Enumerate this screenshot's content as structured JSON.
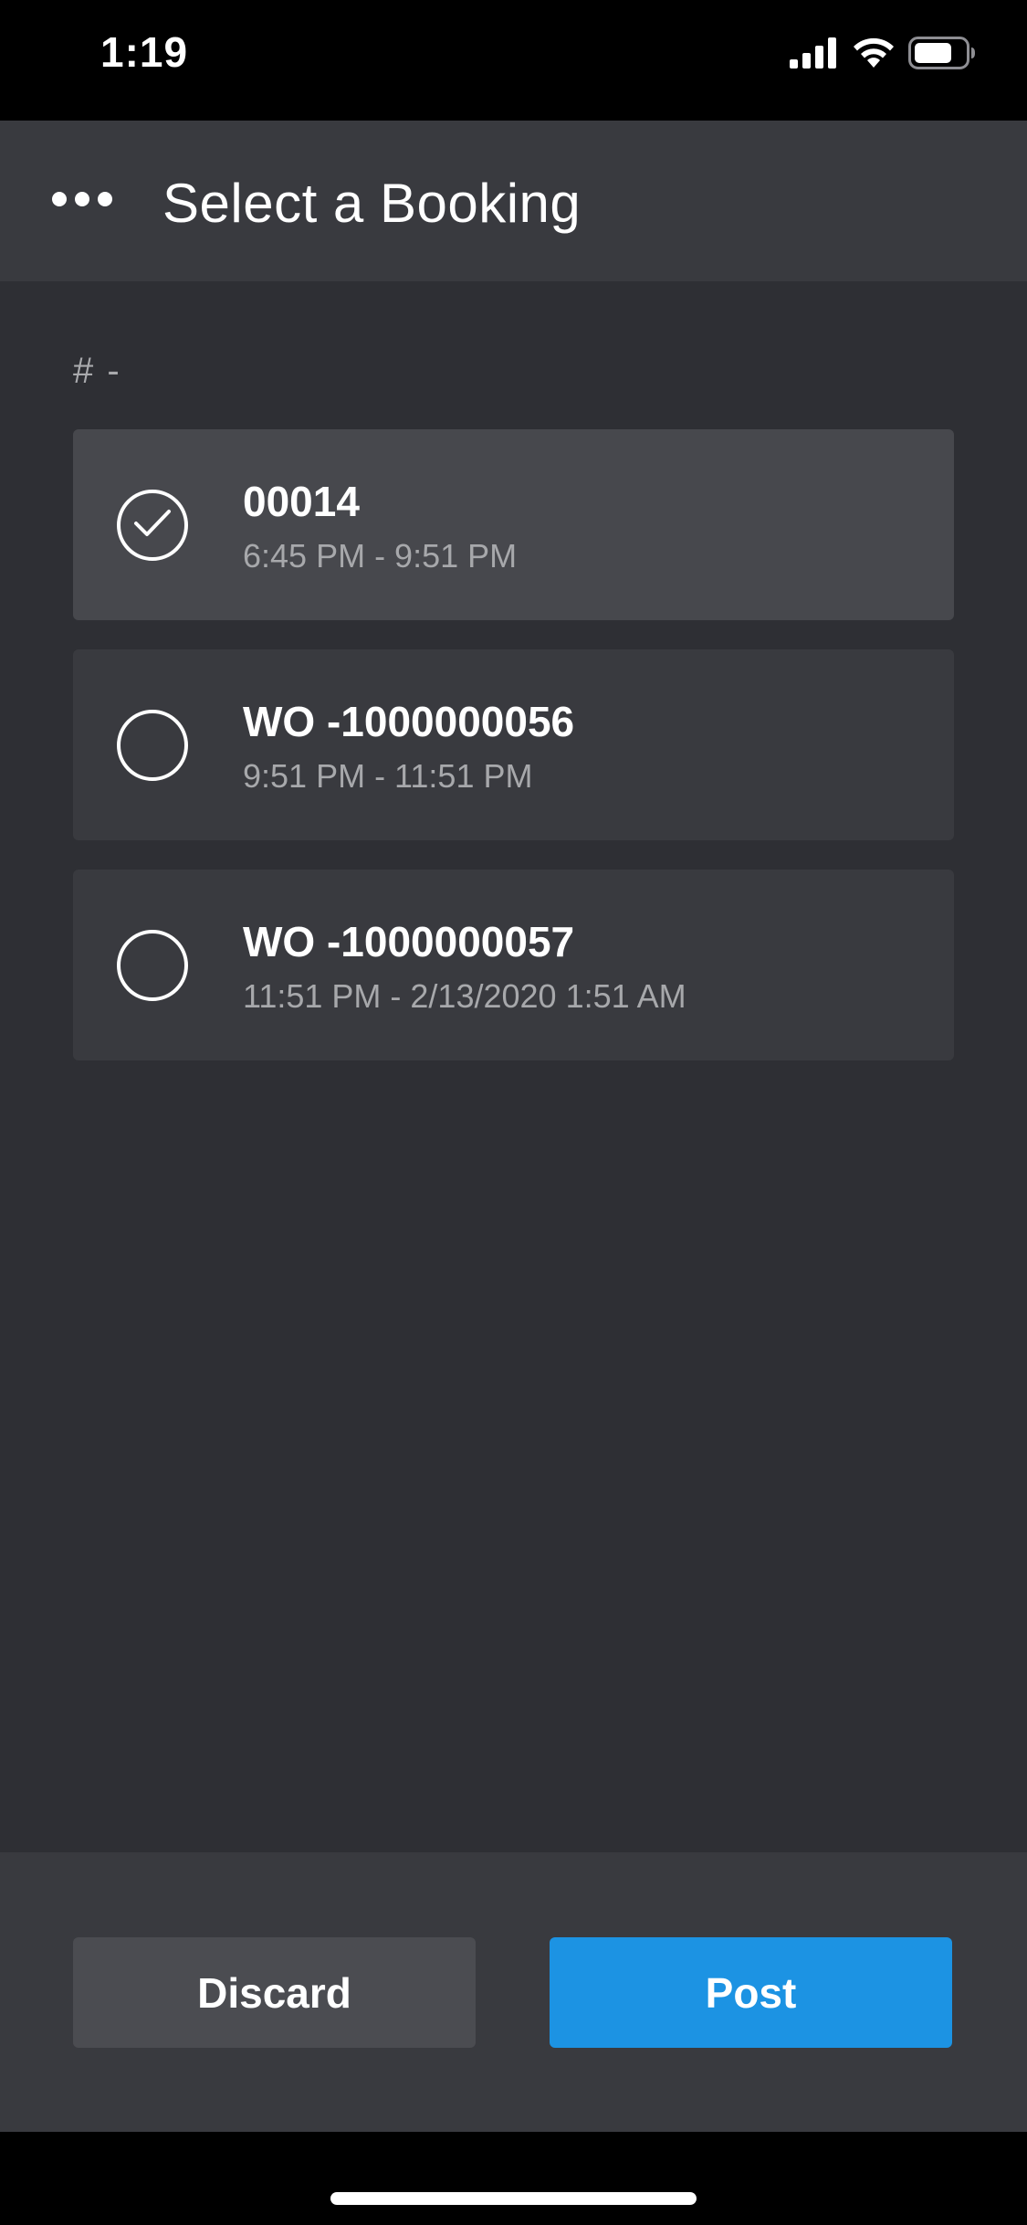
{
  "status_bar": {
    "time": "1:19",
    "icons": [
      "cellular-signal-icon",
      "wifi-icon",
      "battery-icon"
    ]
  },
  "header": {
    "menu_icon": "more-horizontal-icon",
    "title": "Select a Booking"
  },
  "list": {
    "label": "# -",
    "items": [
      {
        "title": "00014",
        "time": "6:45 PM - 9:51 PM",
        "selected": true
      },
      {
        "title": "WO -1000000056",
        "time": "9:51 PM - 11:51 PM",
        "selected": false
      },
      {
        "title": "WO -1000000057",
        "time": "11:51 PM - 2/13/2020 1:51 AM",
        "selected": false
      }
    ]
  },
  "actions": {
    "discard_label": "Discard",
    "post_label": "Post"
  },
  "colors": {
    "accent": "#1c93e3",
    "background": "#2e2f34",
    "header": "#393a3f",
    "selected_item": "#47484d"
  }
}
